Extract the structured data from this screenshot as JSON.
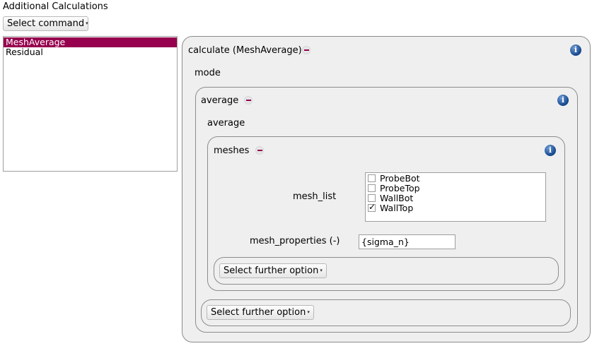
{
  "header": {
    "title": "Additional Calculations"
  },
  "toolbar": {
    "select_command_label": "Select command"
  },
  "command_list": {
    "items": [
      "MeshAverage",
      "Residual"
    ]
  },
  "calculate_panel": {
    "title": "calculate (MeshAverage)",
    "mode_label": "mode"
  },
  "average_panel": {
    "title": "average",
    "average_label": "average"
  },
  "meshes_panel": {
    "title": "meshes",
    "mesh_list_label": "mesh_list",
    "mesh_list": [
      {
        "name": "ProbeBot",
        "checked": false
      },
      {
        "name": "ProbeTop",
        "checked": false
      },
      {
        "name": "WallBot",
        "checked": false
      },
      {
        "name": "WallTop",
        "checked": true
      }
    ],
    "mesh_properties_label": "mesh_properties (-)",
    "mesh_properties_value": "{sigma_n}",
    "further_option_label": "Select further option"
  },
  "outer_further_option_label": "Select further option",
  "colors": {
    "selection": "#96004e",
    "panel_bg": "#efefef",
    "info_icon": "#14468c"
  }
}
